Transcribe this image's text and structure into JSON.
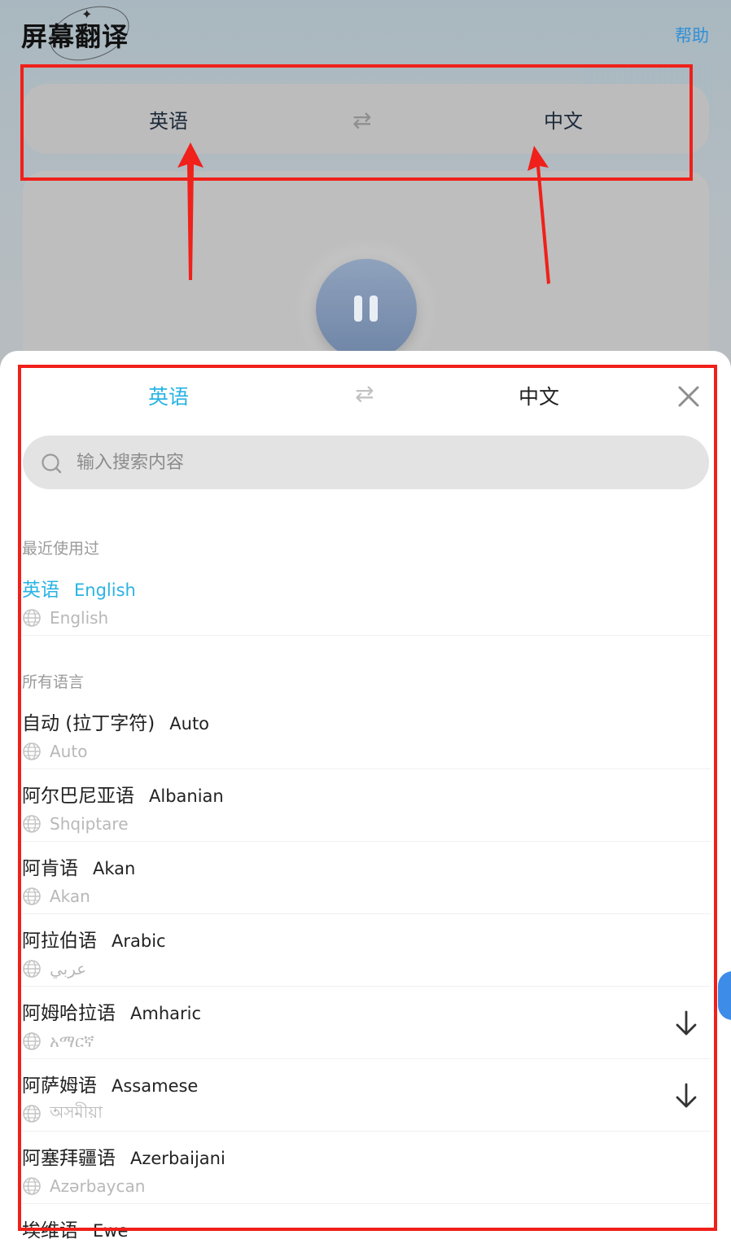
{
  "app": {
    "title": "屏幕翻译",
    "help_label": "帮助"
  },
  "background_bar": {
    "source_lang": "英语",
    "target_lang": "中文",
    "swap_icon": "swap-arrows-icon"
  },
  "background_player": {
    "pause_icon": "pause-icon"
  },
  "sheet": {
    "source_lang": "英语",
    "target_lang": "中文",
    "swap_icon": "swap-arrows-icon",
    "close_icon": "close-icon",
    "search": {
      "placeholder": "输入搜索内容",
      "value": ""
    },
    "recent_title": "最近使用过",
    "recent": [
      {
        "cn": "英语",
        "en": "English",
        "native": "English",
        "selected": true
      }
    ],
    "all_title": "所有语言",
    "languages": [
      {
        "cn": "自动 (拉丁字符)",
        "en": "Auto",
        "native": "Auto",
        "download": false
      },
      {
        "cn": "阿尔巴尼亚语",
        "en": "Albanian",
        "native": "Shqiptare",
        "download": false
      },
      {
        "cn": "阿肯语",
        "en": "Akan",
        "native": "Akan",
        "download": false
      },
      {
        "cn": "阿拉伯语",
        "en": "Arabic",
        "native": "عربي",
        "download": false
      },
      {
        "cn": "阿姆哈拉语",
        "en": "Amharic",
        "native": "አማርኛ",
        "download": true
      },
      {
        "cn": "阿萨姆语",
        "en": "Assamese",
        "native": "অসমীয়া",
        "download": true
      },
      {
        "cn": "阿塞拜疆语",
        "en": "Azerbaijani",
        "native": "Azərbaycan",
        "download": false
      },
      {
        "cn": "埃维语",
        "en": "Ewe",
        "native": "",
        "download": false
      }
    ]
  },
  "colors": {
    "accent": "#29b3e3",
    "annotation_red": "#f0201a",
    "help_link": "#2f8fd8"
  }
}
